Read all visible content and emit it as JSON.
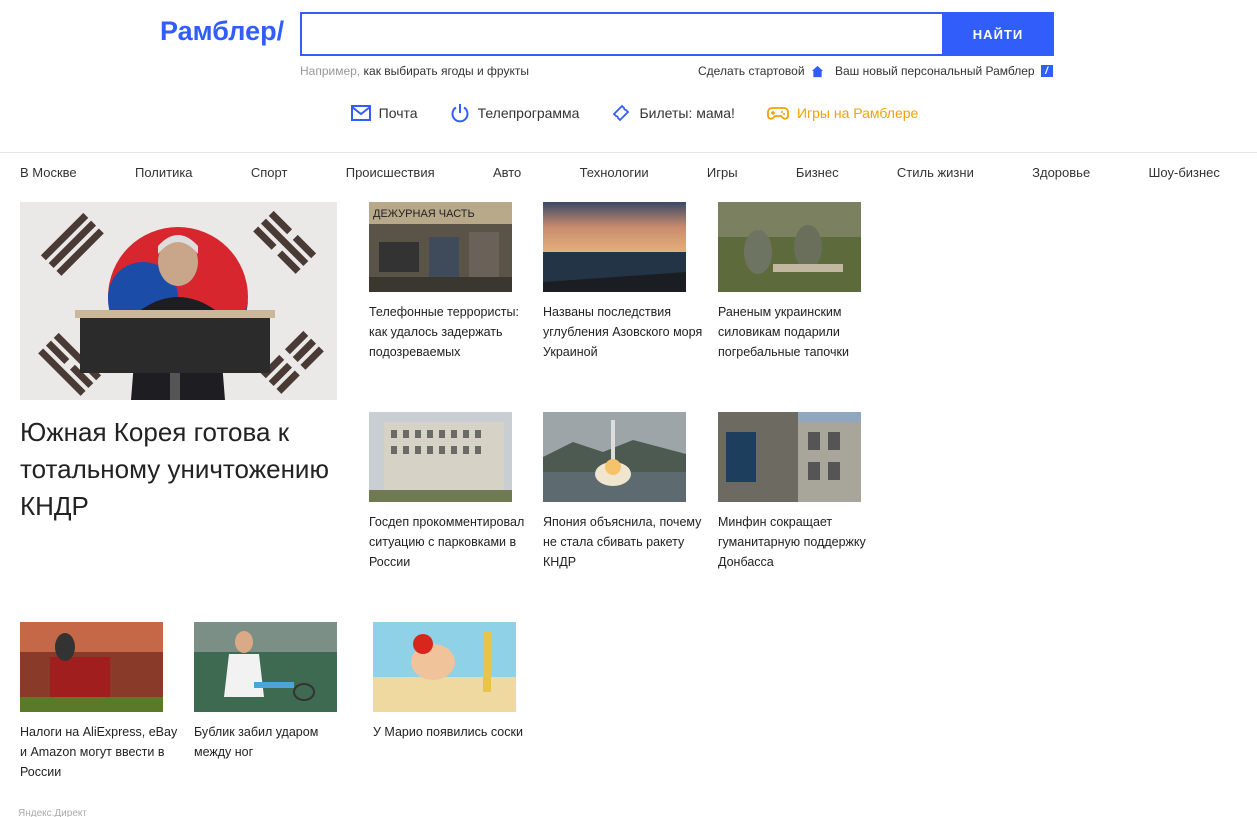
{
  "header": {
    "logo": "Рамблер/",
    "search_placeholder": "",
    "search_button": "НАЙТИ",
    "hint_prefix": "Например,",
    "hint_query": "как выбирать ягоды и фрукты",
    "make_start": "Сделать стартовой",
    "personal": "Ваш новый персональный Рамблер",
    "personal_badge": "/"
  },
  "services": [
    {
      "label": "Почта",
      "icon": "mail-icon"
    },
    {
      "label": "Телепрограмма",
      "icon": "power-icon"
    },
    {
      "label": "Билеты: мама!",
      "icon": "ticket-icon"
    },
    {
      "label": "Игры на Рамблере",
      "icon": "gamepad-icon"
    }
  ],
  "topics": [
    "В Москве",
    "Политика",
    "Спорт",
    "Происшествия",
    "Авто",
    "Технологии",
    "Игры",
    "Бизнес",
    "Стиль жизни",
    "Здоровье",
    "Шоу-бизнес"
  ],
  "hero": {
    "title": "Южная Корея готова к тотальному уничтожению КНДР"
  },
  "news": [
    {
      "text": "Телефонные террористы: как удалось задержать подозреваемых",
      "image_caption": "ДЕЖУРНАЯ ЧАСТЬ"
    },
    {
      "text": "Названы последствия углубления Азовского моря Украиной"
    },
    {
      "text": "Раненым украинским силовикам подарили погребальные тапочки"
    },
    {
      "text": "Госдеп прокомментировал ситуацию с парковками в России"
    },
    {
      "text": "Япония объяснила, почему не стала сбивать ракету КНДР"
    },
    {
      "text": "Минфин сокращает гуманитарную поддержку Донбасса"
    },
    {
      "text": "Налоги на AliExpress, eBay и Amazon могут ввести в России"
    },
    {
      "text": "Бублик забил ударом между ног"
    },
    {
      "text": "У Марио появились соски"
    }
  ],
  "footer": {
    "ad_label": "Яндекс.Директ"
  },
  "colors": {
    "brand": "#315efb",
    "games": "#f5a005"
  }
}
